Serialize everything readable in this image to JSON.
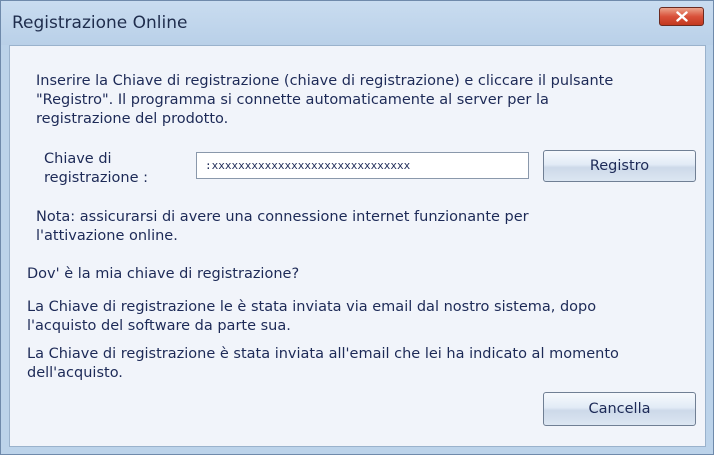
{
  "window": {
    "title": "Registrazione Online"
  },
  "intro": {
    "line1": "Inserire la Chiave di registrazione (chiave di registrazione) e cliccare il pulsante",
    "line2": "\"Registro\". Il programma si connette automaticamente al server per la",
    "line3": "registrazione del prodotto."
  },
  "key_field": {
    "label_line1": "Chiave di",
    "label_line2": "registrazione :",
    "value": ":xxxxxxxxxxxxxxxxxxxxxxxxxxxxxx"
  },
  "buttons": {
    "register": "Registro",
    "cancel": "Cancella"
  },
  "note": {
    "line1": "Nota: assicurarsi di avere una connessione internet funzionante per",
    "line2": "l'attivazione online."
  },
  "question": "Dov' è la mia chiave di registrazione?",
  "answer1": {
    "line1": "La Chiave di registrazione le è stata inviata via email dal nostro sistema, dopo",
    "line2": "l'acquisto del software da parte sua."
  },
  "answer2": {
    "line1": "La Chiave di registrazione è stata inviata all'email che lei ha indicato al momento",
    "line2": "dell'acquisto."
  },
  "icons": {
    "close": "close-icon"
  }
}
